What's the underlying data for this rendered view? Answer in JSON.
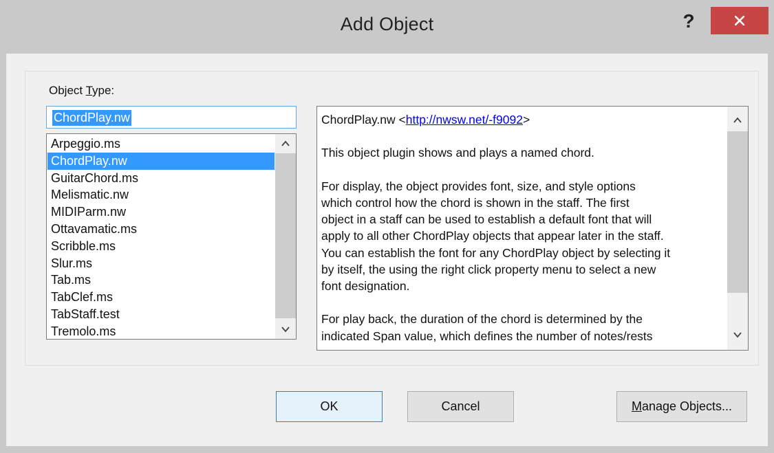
{
  "window": {
    "title": "Add Object",
    "help_label": "?"
  },
  "form": {
    "object_type_label_prefix": "Object ",
    "object_type_label_accel": "T",
    "object_type_label_suffix": "ype:",
    "name_value": "ChordPlay.nw"
  },
  "list": {
    "items": [
      {
        "label": "Arpeggio.ms",
        "selected": false
      },
      {
        "label": "ChordPlay.nw",
        "selected": true
      },
      {
        "label": "GuitarChord.ms",
        "selected": false
      },
      {
        "label": "Melismatic.nw",
        "selected": false
      },
      {
        "label": "MIDIParm.nw",
        "selected": false
      },
      {
        "label": "Ottavamatic.ms",
        "selected": false
      },
      {
        "label": "Scribble.ms",
        "selected": false
      },
      {
        "label": "Slur.ms",
        "selected": false
      },
      {
        "label": "Tab.ms",
        "selected": false
      },
      {
        "label": "TabClef.ms",
        "selected": false
      },
      {
        "label": "TabStaff.test",
        "selected": false
      },
      {
        "label": "Tremolo.ms",
        "selected": false
      }
    ]
  },
  "description": {
    "header_name": "ChordPlay.nw <",
    "link": "http://nwsw.net/-f9092",
    "header_close": ">",
    "para1": "This object plugin shows and plays a named chord.",
    "para2_lines": [
      "For display, the object provides font, size, and style options",
      "which control how the chord is shown in the staff. The first",
      "object in a staff can be used to establish a default font that will",
      "apply to all other ChordPlay objects that appear later in the staff.",
      "You can establish the font for any ChordPlay object by selecting it",
      "by itself, the using the right click property menu to select a new",
      "font designation."
    ],
    "para3_lines": [
      "For play back, the duration of the chord is determined by the",
      "indicated Span value, which defines the number of notes/rests"
    ]
  },
  "buttons": {
    "ok": "OK",
    "cancel": "Cancel",
    "manage_accel": "M",
    "manage_rest": "anage Objects..."
  },
  "colors": {
    "selection": "#3399ff",
    "close_button": "#c74545",
    "link": "#0000ee"
  },
  "icons": {
    "help": "question-mark",
    "close": "close-x",
    "scroll_up": "chevron-up",
    "scroll_down": "chevron-down"
  }
}
